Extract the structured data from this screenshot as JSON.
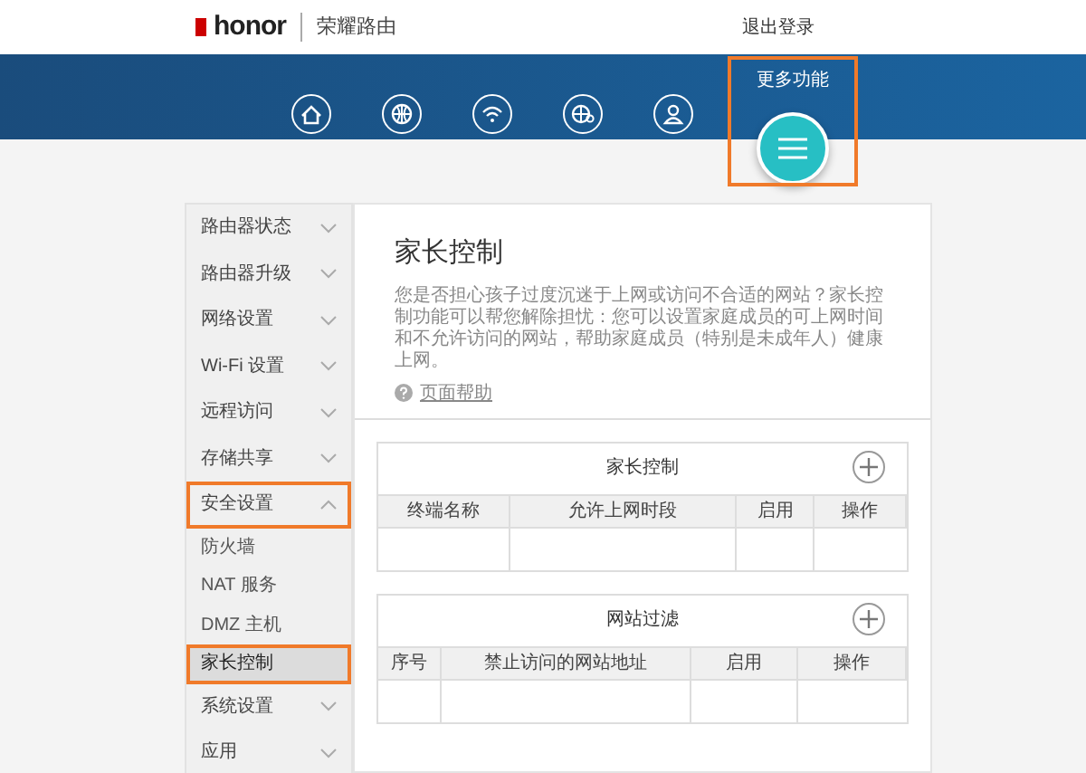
{
  "header": {
    "logo_text": "honor",
    "product_name": "荣耀路由",
    "logout_link": "退出登录"
  },
  "nav": {
    "items": [
      {
        "kind": "home",
        "selected": false
      },
      {
        "kind": "globe",
        "selected": false
      },
      {
        "kind": "wifi",
        "selected": false
      },
      {
        "kind": "globe-gear",
        "selected": false
      },
      {
        "kind": "person",
        "selected": false
      }
    ],
    "more": {
      "label": "更多功能",
      "selected": true,
      "highlighted": true
    }
  },
  "sidebar": {
    "items": [
      {
        "label": "路由器状态",
        "expanded": false,
        "highlighted": false
      },
      {
        "label": "路由器升级",
        "expanded": false,
        "highlighted": false
      },
      {
        "label": "网络设置",
        "expanded": false,
        "highlighted": false
      },
      {
        "label": "Wi-Fi 设置",
        "expanded": false,
        "highlighted": false
      },
      {
        "label": "远程访问",
        "expanded": false,
        "highlighted": false
      },
      {
        "label": "存储共享",
        "expanded": false,
        "highlighted": false
      },
      {
        "label": "安全设置",
        "expanded": true,
        "highlighted": true,
        "children": [
          {
            "label": "防火墙",
            "selected": false,
            "highlighted": false
          },
          {
            "label": "NAT 服务",
            "selected": false,
            "highlighted": false
          },
          {
            "label": "DMZ 主机",
            "selected": false,
            "highlighted": false
          },
          {
            "label": "家长控制",
            "selected": true,
            "highlighted": true
          }
        ]
      },
      {
        "label": "系统设置",
        "expanded": false,
        "highlighted": false
      },
      {
        "label": "应用",
        "expanded": false,
        "highlighted": false
      }
    ]
  },
  "main": {
    "title": "家长控制",
    "description": "您是否担心孩子过度沉迷于上网或访问不合适的网站？家长控制功能可以帮您解除担忧：您可以设置家庭成员的可上网时间和不允许访问的网站，帮助家庭成员（特别是未成年人）健康上网。",
    "help_link": "页面帮助",
    "tables": [
      {
        "title": "家长控制",
        "columns": [
          "终端名称",
          "允许上网时段",
          "启用",
          "操作"
        ]
      },
      {
        "title": "网站过滤",
        "columns": [
          "序号",
          "禁止访问的网站地址",
          "启用",
          "操作"
        ]
      }
    ]
  }
}
